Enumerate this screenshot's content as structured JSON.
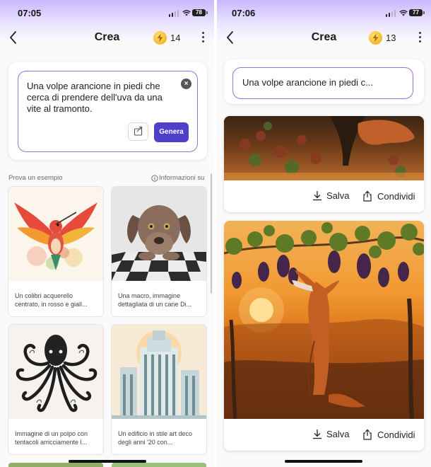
{
  "left": {
    "status": {
      "time": "07:05",
      "battery": "78"
    },
    "header": {
      "title": "Crea",
      "coins": "14"
    },
    "prompt": {
      "text": "Una volpe arancione in piedi che cerca di prendere dell'uva da una vite al tramonto.",
      "generate_label": "Genera"
    },
    "examples": {
      "heading": "Prova un esempio",
      "info": "Informazioni su",
      "items": [
        {
          "caption": "Un colibrì acquerello centrato, in rosso e giall..."
        },
        {
          "caption": "Una macro, immagine dettagliata di un cane Di..."
        },
        {
          "caption": "Immagine di un polpo con tentacoli arricciamente l..."
        },
        {
          "caption": "Un edificio in stile art deco degli anni '20 con..."
        }
      ]
    }
  },
  "right": {
    "status": {
      "time": "07:06",
      "battery": "77"
    },
    "header": {
      "title": "Crea",
      "coins": "13"
    },
    "prompt": {
      "text": "Una volpe arancione in piedi c..."
    },
    "results": [
      {
        "save_label": "Salva",
        "share_label": "Condividi"
      },
      {
        "save_label": "Salva",
        "share_label": "Condividi"
      }
    ]
  },
  "colors": {
    "accent": "#4f3fc9",
    "prompt_border": "#a56cdc",
    "header_gradient": "#c8b8ff"
  },
  "icons": [
    "back-chevron-icon",
    "lightning-coin-icon",
    "kebab-menu-icon",
    "clear-icon",
    "share-icon",
    "info-icon",
    "download-icon"
  ]
}
